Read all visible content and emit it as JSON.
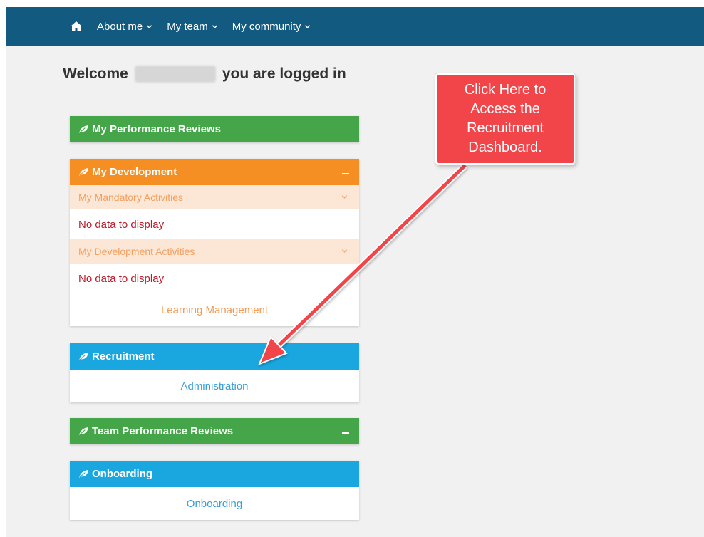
{
  "nav": {
    "items": [
      {
        "label": "About me",
        "icon": "chevron-down-icon"
      },
      {
        "label": "My team",
        "icon": "chevron-down-icon"
      },
      {
        "label": "My community",
        "icon": "chevron-down-icon"
      }
    ],
    "home_icon": "home-icon"
  },
  "welcome": {
    "prefix": "Welcome",
    "suffix": "you are logged in"
  },
  "widgets": {
    "performance": {
      "title": "My Performance Reviews"
    },
    "development": {
      "title": "My Development",
      "mandatory_label": "My Mandatory Activities",
      "mandatory_empty": "No data to display",
      "dev_label": "My Development Activities",
      "dev_empty": "No data to display",
      "link": "Learning Management"
    },
    "recruitment": {
      "title": "Recruitment",
      "link": "Administration"
    },
    "team": {
      "title": "Team Performance Reviews"
    },
    "onboarding": {
      "title": "Onboarding",
      "link": "Onboarding"
    }
  },
  "callout": {
    "text": "Click Here to Access the Recruitment Dashboard."
  },
  "colors": {
    "navbar": "#125a7f",
    "green": "#44a649",
    "orange": "#f68f23",
    "blue": "#1aa7e0",
    "callout": "#f1454a",
    "error_text": "#c0182a"
  }
}
